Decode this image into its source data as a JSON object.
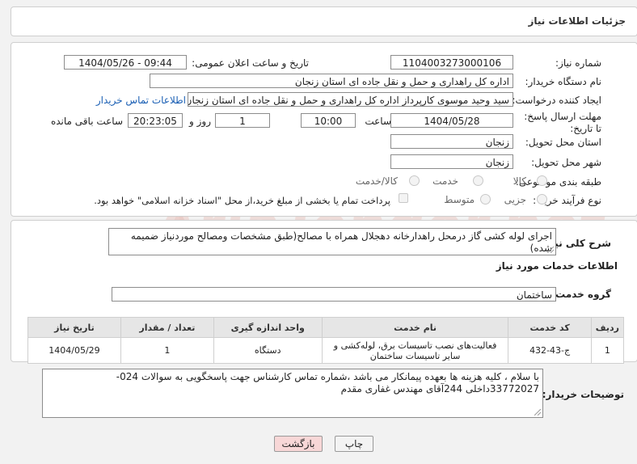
{
  "header": {
    "title": "جزئیات اطلاعات نیاز"
  },
  "form": {
    "need_number_label": "شماره نیاز:",
    "need_number": "1104003273000106",
    "announce_label": "تاریخ و ساعت اعلان عمومی:",
    "announce_value": "1404/05/26 - 09:44",
    "buyer_org_label": "نام دستگاه خریدار:",
    "buyer_org": "اداره کل راهداری و حمل و نقل جاده ای استان زنجان",
    "creator_label": "ایجاد کننده درخواست:",
    "creator": "سید وحید موسوی کارپرداز اداره کل راهداری و حمل و نقل جاده ای استان زنجان",
    "contact_link": "اطلاعات تماس خریدار",
    "deadline_label": "مهلت ارسال پاسخ: تا تاریخ:",
    "deadline_date": "1404/05/28",
    "time_label": "ساعت",
    "deadline_time": "10:00",
    "days_value": "1",
    "days_label": "روز و",
    "remaining_time": "20:23:05",
    "remaining_label": "ساعت باقی مانده",
    "province_label": "استان محل تحویل:",
    "province": "زنجان",
    "city_label": "شهر محل تحویل:",
    "city": "زنجان",
    "category_label": "طبقه بندی موضوعی:",
    "category_options": [
      "کالا",
      "خدمت",
      "کالا/خدمت"
    ],
    "process_label": "نوع فرآیند خرید :",
    "process_options": [
      "جزیی",
      "متوسط"
    ],
    "payment_note": "پرداخت تمام یا بخشی از مبلغ خرید،از محل \"اسناد خزانه اسلامی\" خواهد بود."
  },
  "description": {
    "label": "شرح کلی نیاز:",
    "text": "اجرای لوله کشی گاز درمحل راهدارخانه دهجلال همراه با مصالح(طبق مشخصات ومصالح موردنیاز ضمیمه شده)"
  },
  "services": {
    "section_title": "اطلاعات خدمات مورد نیاز",
    "group_label": "گروه خدمت:",
    "group_value": "ساختمان",
    "columns": [
      "ردیف",
      "کد خدمت",
      "نام خدمت",
      "واحد اندازه گیری",
      "تعداد / مقدار",
      "تاریخ نیاز"
    ],
    "rows": [
      [
        "1",
        "ج-43-432",
        "فعالیت‌های نصب تاسیسات برق، لوله‌کشی و سایر تاسیسات ساختمان",
        "دستگاه",
        "1",
        "1404/05/29"
      ]
    ]
  },
  "buyer_notes": {
    "label": "توضیحات خریدار:",
    "line1": "با سلام ، کلیه هزینه ها بعهده پیمانکار می باشد ،شماره تماس کارشناس جهت پاسخگویی به سوالات 024-",
    "line2": "33772027داخلی 244آقای مهندس غفاری مقدم"
  },
  "buttons": {
    "print": "چاپ",
    "back": "بازگشت"
  },
  "watermark": {
    "text": "AriaTender.net"
  },
  "colors": {
    "link": "#1a5fb4",
    "back_button_bg": "#f8d7d7",
    "print_button_bg": "#f3f3f3"
  }
}
